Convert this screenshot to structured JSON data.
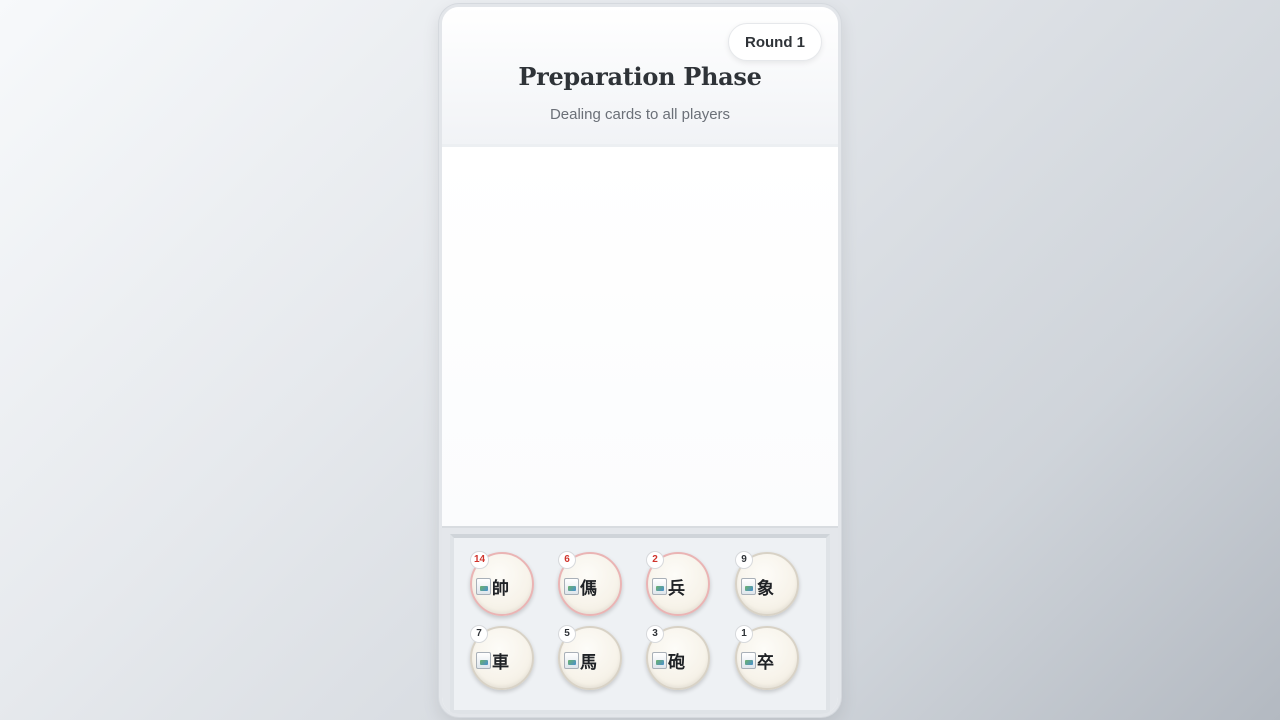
{
  "header": {
    "round_label": "Round 1",
    "title": "Preparation Phase",
    "subtitle": "Dealing cards to all players"
  },
  "hand": {
    "pieces": [
      {
        "char": "帥",
        "count": "14",
        "color": "red"
      },
      {
        "char": "傌",
        "count": "6",
        "color": "red"
      },
      {
        "char": "兵",
        "count": "2",
        "color": "red"
      },
      {
        "char": "象",
        "count": "9",
        "color": "black"
      },
      {
        "char": "車",
        "count": "7",
        "color": "black"
      },
      {
        "char": "馬",
        "count": "5",
        "color": "black"
      },
      {
        "char": "砲",
        "count": "3",
        "color": "black"
      },
      {
        "char": "卒",
        "count": "1",
        "color": "black"
      }
    ]
  },
  "colors": {
    "red_piece_border": "#eab4b4",
    "red_count": "#d0342c",
    "text_dark": "#2f3338"
  }
}
